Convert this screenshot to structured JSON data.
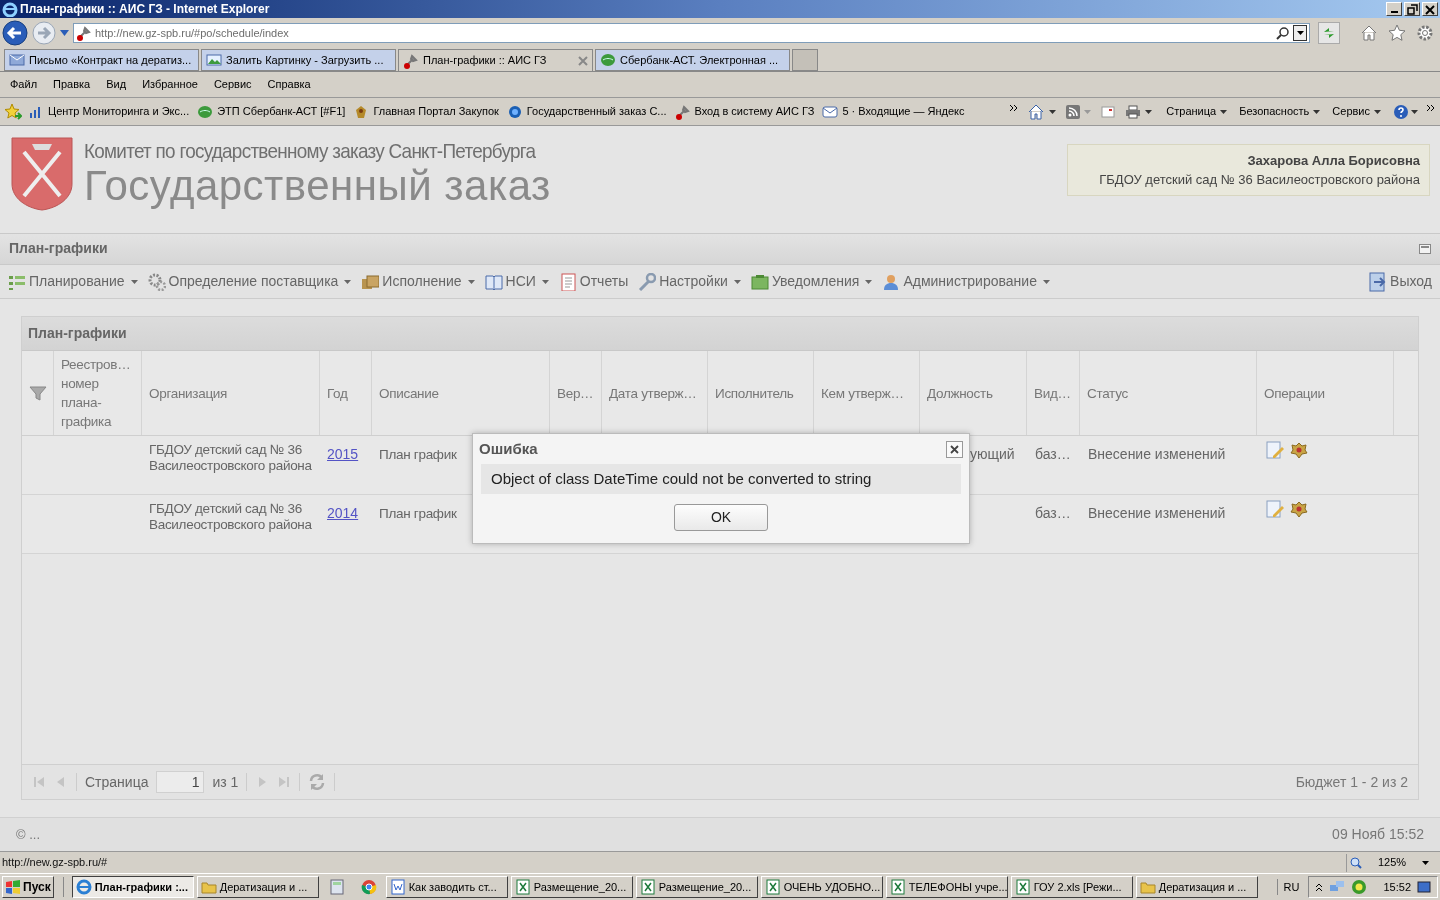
{
  "window": {
    "title": "План-графики :: АИС ГЗ - Internet Explorer"
  },
  "browser": {
    "address": "http://new.gz-spb.ru/#po/schedule/index",
    "tabs": [
      {
        "label": "Письмо «Контракт на дератиз...",
        "selected": false
      },
      {
        "label": "Залить Картинку - Загрузить ...",
        "selected": false
      },
      {
        "label": "План-графики :: АИС ГЗ",
        "selected": true
      },
      {
        "label": "Сбербанк-АСТ. Электронная ...",
        "selected": false
      }
    ],
    "menu": [
      "Файл",
      "Правка",
      "Вид",
      "Избранное",
      "Сервис",
      "Справка"
    ],
    "favorites": [
      "Центр Мониторинга и Экс...",
      "ЭТП Сбербанк-АСТ [#F1]",
      "Главная Портал Закупок",
      "Государственный заказ С...",
      "Вход в систему  АИС ГЗ",
      "5 · Входящие — Яндекс"
    ],
    "command_bar": [
      "Страница",
      "Безопасность",
      "Сервис"
    ]
  },
  "page": {
    "header": {
      "committee": "Комитет по государственному заказу Санкт-Петербурга",
      "title": "Государственный заказ"
    },
    "user": {
      "name": "Захарова Алла Борисовна",
      "organization": "ГБДОУ детский сад № 36 Василеостровского района"
    },
    "section_title": "План-графики",
    "toolbar": [
      {
        "label": "Планирование",
        "dropdown": true
      },
      {
        "label": "Определение поставщика",
        "dropdown": true
      },
      {
        "label": "Исполнение",
        "dropdown": true
      },
      {
        "label": "НСИ",
        "dropdown": true
      },
      {
        "label": "Отчеты",
        "dropdown": false
      },
      {
        "label": "Настройки",
        "dropdown": true
      },
      {
        "label": "Уведомления",
        "dropdown": true
      },
      {
        "label": "Администрирование",
        "dropdown": true
      }
    ],
    "exit": "Выход",
    "grid": {
      "title": "План-графики",
      "columns": [
        "Реестров… номер плана-графика",
        "Организация",
        "Год",
        "Описание",
        "Вер…",
        "Дата утверж…",
        "Исполнитель",
        "Кем утверж…",
        "Должность",
        "Вид…",
        "Статус",
        "Операции"
      ],
      "rows": [
        {
          "organization": "ГБДОУ детский сад № 36 Василеостровского района",
          "year": "2015",
          "description": "План график",
          "position": "ующий",
          "kind": "баз…",
          "status": "Внесение изменений"
        },
        {
          "organization": "ГБДОУ детский сад № 36 Василеостровского района",
          "year": "2014",
          "description": "План график",
          "kind": "баз…",
          "status": "Внесение изменений"
        }
      ]
    },
    "pager": {
      "page_label": "Страница",
      "page": "1",
      "of": "из 1",
      "summary": "Бюджет 1 - 2 из 2"
    },
    "footer": {
      "copyright": "© ...",
      "datetime": "09 Нояб 15:52"
    },
    "dialog": {
      "title": "Ошибка",
      "message": "Object of class DateTime could not be converted to string",
      "button": "OK"
    }
  },
  "status_bar": {
    "url": "http://new.gz-spb.ru/#",
    "zoom": "125%"
  },
  "taskbar": {
    "start": "Пуск",
    "items": [
      {
        "label": "План-графики :...",
        "selected": true
      },
      {
        "label": "Дератизация и ...",
        "selected": false
      },
      {
        "label": "Как заводить ст...",
        "selected": false
      },
      {
        "label": "Размещение_20...",
        "selected": false
      },
      {
        "label": "Размещение_20...",
        "selected": false
      },
      {
        "label": "ОЧЕНЬ УДОБНО...",
        "selected": false
      },
      {
        "label": "ТЕЛЕФОНЫ учре...",
        "selected": false
      },
      {
        "label": "ГОУ 2.xls  [Режи...",
        "selected": false
      },
      {
        "label": "Дератизация и ...",
        "selected": false
      }
    ],
    "language": "RU",
    "time": "15:52"
  }
}
